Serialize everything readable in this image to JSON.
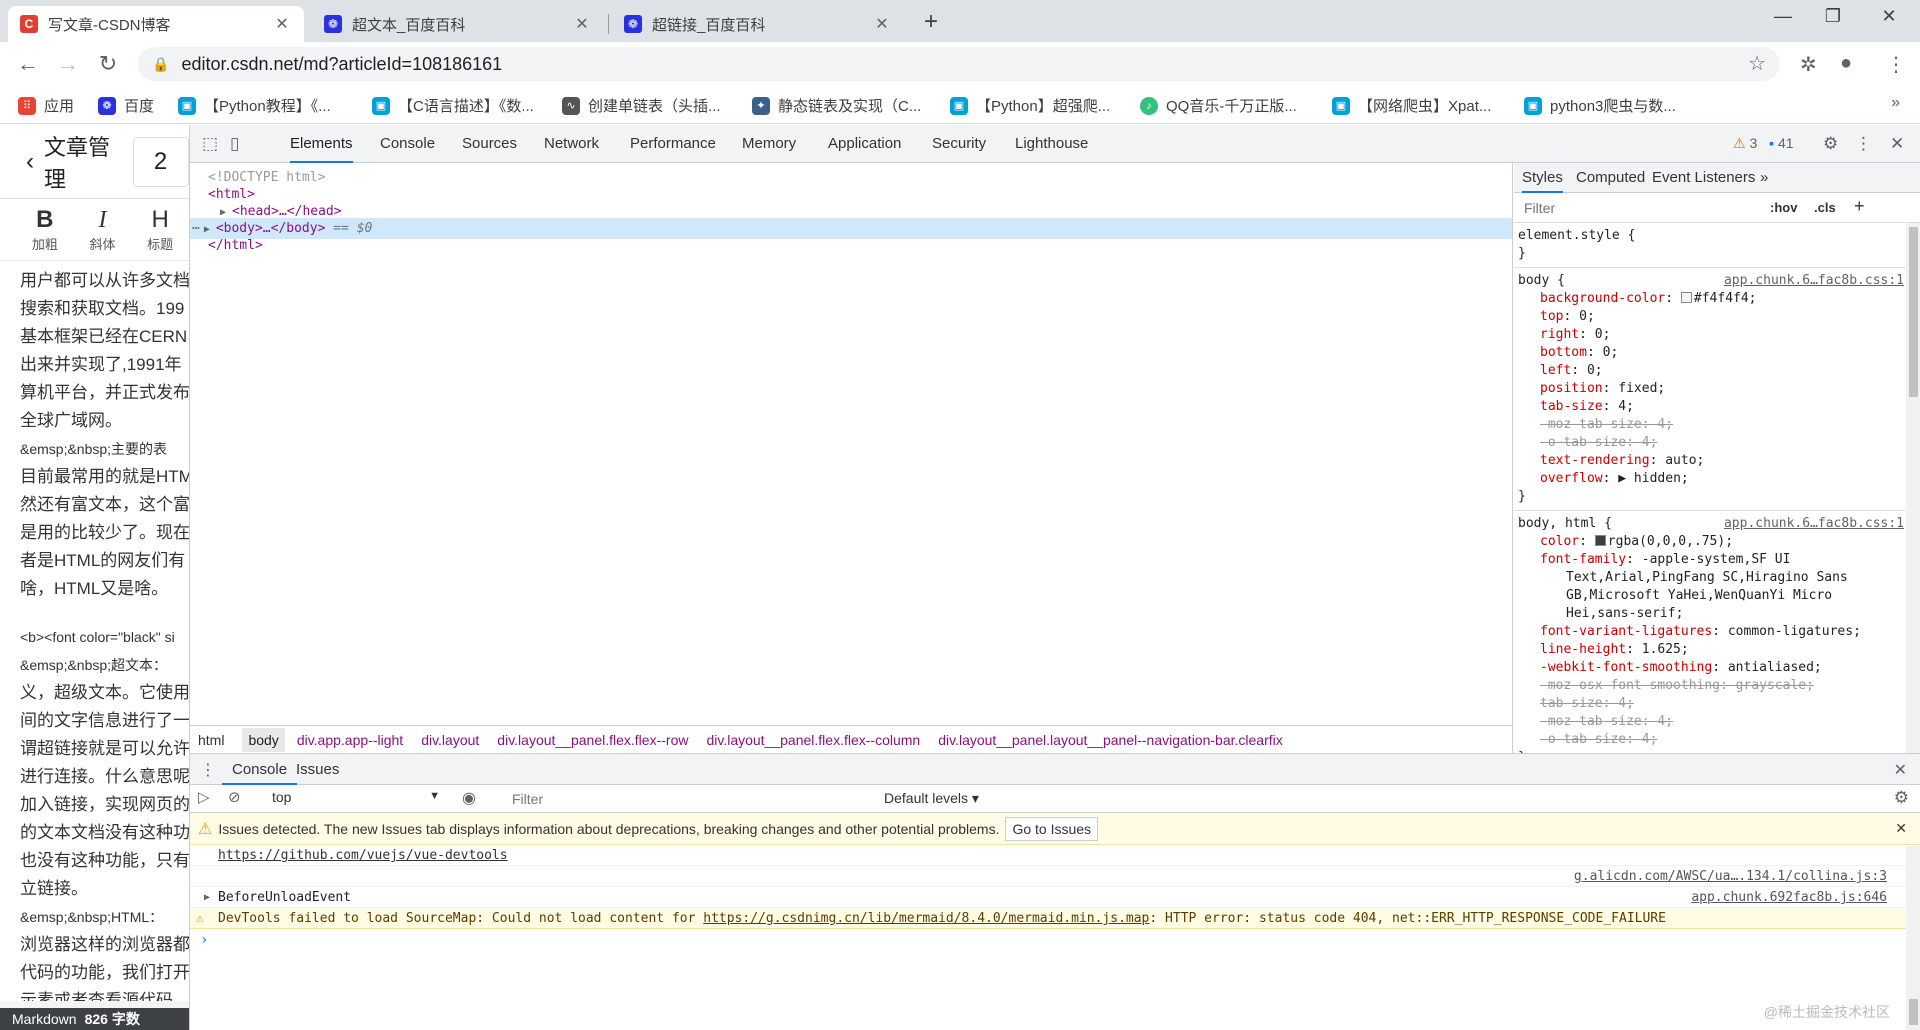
{
  "browser": {
    "tabs": [
      {
        "title": "写文章-CSDN博客",
        "icon": "csdn-logo-icon",
        "active": true
      },
      {
        "title": "超文本_百度百科",
        "icon": "baidu-paw-icon",
        "active": false
      },
      {
        "title": "超链接_百度百科",
        "icon": "baidu-paw-icon",
        "active": false
      }
    ],
    "url": "editor.csdn.net/md?articleId=108186161",
    "bookmarks": [
      {
        "label": "应用",
        "icon": "apps-grid-icon"
      },
      {
        "label": "百度",
        "icon": "baidu-paw-icon"
      },
      {
        "label": "【Python教程】《...",
        "icon": "bilibili-icon"
      },
      {
        "label": "【C语言描述】《数...",
        "icon": "bilibili-icon"
      },
      {
        "label": "创建单链表（头插...",
        "icon": "link-icon"
      },
      {
        "label": "静态链表及实现（C...",
        "icon": "bird-icon"
      },
      {
        "label": "【Python】超强爬...",
        "icon": "bilibili-icon"
      },
      {
        "label": "QQ音乐-千万正版...",
        "icon": "qq-music-icon"
      },
      {
        "label": "【网络爬虫】Xpat...",
        "icon": "bilibili-icon"
      },
      {
        "label": "python3爬虫与数...",
        "icon": "bilibili-icon"
      }
    ]
  },
  "page": {
    "header_title": "文章管理",
    "title_input_value": "2",
    "tools": [
      {
        "glyph": "B",
        "label": "加粗"
      },
      {
        "glyph": "I",
        "label": "斜体"
      },
      {
        "glyph": "H",
        "label": "标题"
      }
    ],
    "lines": [
      "用户都可以从许多文档",
      "搜索和获取文档。199",
      "基本框架已经在CERN",
      "出来并实现了,1991年",
      "算机平台，并正式发布",
      "全球广域网。",
      "&emsp;&nbsp;主要的表",
      "目前最常用的就是HTM",
      "然还有富文本，这个富",
      "是用的比较少了。现在",
      "者是HTML的网友们有",
      "啥，HTML又是啥。",
      "",
      "<b><font color=\"black\" si",
      "&emsp;&nbsp;超文本：",
      "义，超级文本。它使用",
      "间的文字信息进行了一",
      "谓超链接就是可以允许",
      "进行连接。什么意思呢",
      "加入链接，实现网页的",
      "的文本文档没有这种功",
      "也没有这种功能，只有",
      "立链接。",
      "&emsp;&nbsp;HTML：",
      "浏览器这样的浏览器都",
      "代码的功能，我们打开",
      "示素或者查看源代码"
    ],
    "status_mode": "Markdown",
    "status_count": "826 字数"
  },
  "devtools": {
    "tabs": [
      "Elements",
      "Console",
      "Sources",
      "Network",
      "Performance",
      "Memory",
      "Application",
      "Security",
      "Lighthouse"
    ],
    "active_tab": "Elements",
    "warning_count": "3",
    "message_count": "41",
    "dom": {
      "doctype": "<!DOCTYPE html>",
      "html_open": "<html>",
      "head": "<head>…</head>",
      "body": "<body>…</body>",
      "body_eq": "== $0",
      "html_close": "</html>"
    },
    "breadcrumbs": [
      "html",
      "body",
      "div.app.app--light",
      "div.layout",
      "div.layout__panel.flex.flex--row",
      "div.layout__panel.flex.flex--column",
      "div.layout__panel.layout__panel--navigation-bar.clearfix"
    ],
    "styles": {
      "tabs": [
        "Styles",
        "Computed",
        "Event Listeners"
      ],
      "filter_placeholder": "Filter",
      "hov": ":hov",
      "cls": ".cls",
      "element_style": "element.style {",
      "close_brace": "}",
      "rules": [
        {
          "selector": "body {",
          "source": "app.chunk.6…fac8b.css:1",
          "decls": [
            {
              "p": "background-color",
              "v": "#f4f4f4;",
              "swatch": "#f4f4f4",
              "strike": false
            },
            {
              "p": "top",
              "v": "0;",
              "strike": false
            },
            {
              "p": "right",
              "v": "0;",
              "strike": false
            },
            {
              "p": "bottom",
              "v": "0;",
              "strike": false
            },
            {
              "p": "left",
              "v": "0;",
              "strike": false
            },
            {
              "p": "position",
              "v": "fixed;",
              "strike": false
            },
            {
              "p": "tab-size",
              "v": "4;",
              "strike": false
            },
            {
              "p": "-moz-tab-size",
              "v": "4;",
              "strike": true
            },
            {
              "p": "-o-tab-size",
              "v": "4;",
              "strike": true
            },
            {
              "p": "text-rendering",
              "v": "auto;",
              "strike": false
            },
            {
              "p": "overflow",
              "v": "▶ hidden;",
              "strike": false
            }
          ]
        },
        {
          "selector": "body, html {",
          "source": "app.chunk.6…fac8b.css:1",
          "decls": [
            {
              "p": "color",
              "v": "rgba(0,0,0,.75);",
              "swatch": "#404040",
              "strike": false
            },
            {
              "p": "font-family",
              "v": "-apple-system,SF UI",
              "strike": false
            },
            {
              "p": "",
              "v": "Text,Arial,PingFang SC,Hiragino Sans",
              "wrap": true
            },
            {
              "p": "",
              "v": "GB,Microsoft YaHei,WenQuanYi Micro",
              "wrap": true
            },
            {
              "p": "",
              "v": "Hei,sans-serif;",
              "wrap": true
            },
            {
              "p": "font-variant-ligatures",
              "v": "common-ligatures;",
              "strike": false
            },
            {
              "p": "line-height",
              "v": "1.625;",
              "strike": false
            },
            {
              "p": "-webkit-font-smoothing",
              "v": "antialiased;",
              "strike": false
            },
            {
              "p": "-moz-osx-font-smoothing",
              "v": "grayscale;",
              "strike": true
            },
            {
              "p": "tab-size",
              "v": "4;",
              "strike": true
            },
            {
              "p": "-moz-tab-size",
              "v": "4;",
              "strike": true
            },
            {
              "p": "-o-tab-size",
              "v": "4;",
              "strike": true
            }
          ]
        }
      ]
    },
    "drawer": {
      "tabs": [
        "Console",
        "Issues"
      ],
      "context": "top",
      "filter_placeholder": "Filter",
      "levels": "Default levels",
      "issues_message": "Issues detected. The new Issues tab displays information about deprecations, breaking changes and other potential problems.",
      "goto_issues": "Go to Issues",
      "log_link": "https://github.com/vuejs/vue-devtools",
      "src1": "g.alicdn.com/AWSC/ua….134.1/collina.js:3",
      "event": "BeforeUnloadEvent",
      "src2": "app.chunk.692fac8b.js:646",
      "warning_pre": "DevTools failed to load SourceMap: Could not load content for ",
      "warning_link": "https://g.csdnimg.cn/lib/mermaid/8.4.0/mermaid.min.js.map",
      "warning_post": ": HTTP error: status code 404, net::ERR_HTTP_RESPONSE_CODE_FAILURE",
      "prompt": "›"
    }
  },
  "watermark": "@稀土掘金技术社区"
}
